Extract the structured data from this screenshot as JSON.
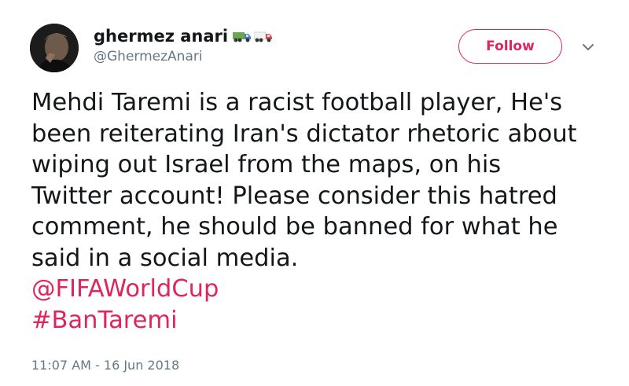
{
  "user": {
    "display_name": "ghermez anari",
    "handle": "@GhermezAnari",
    "avatar_icon": "profile-photo",
    "name_emoji": [
      "truck-icon",
      "truck-icon"
    ]
  },
  "follow_button": {
    "label": "Follow"
  },
  "menu_icon": "chevron-down-icon",
  "tweet": {
    "lines": [
      "Mehdi Taremi is a racist football player, He's",
      "been reiterating Iran's dictator rhetoric about",
      "wiping out Israel from the maps, on his",
      "Twitter account! Please consider this hatred",
      "comment, he should be banned for what he",
      "said in a social media."
    ],
    "mention": "@FIFAWorldCup",
    "hashtag": "#BanTaremi"
  },
  "timestamp": "11:07 AM - 16 Jun 2018",
  "colors": {
    "accent": "#e0245e",
    "text": "#14171a",
    "secondary": "#657786"
  }
}
